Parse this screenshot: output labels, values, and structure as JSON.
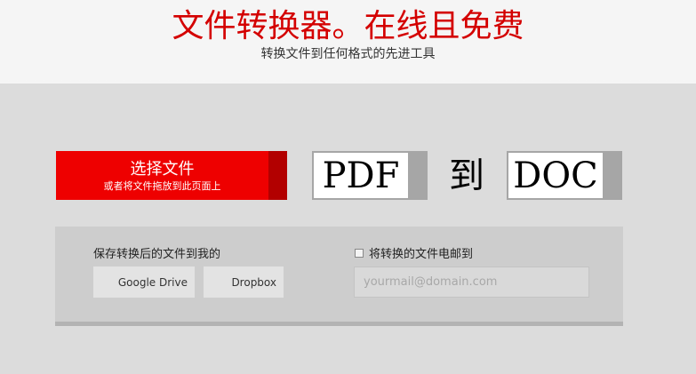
{
  "header": {
    "title": "文件转换器。在线且免费",
    "subtitle": "转换文件到任何格式的先进工具"
  },
  "converter": {
    "choose_label": "选择文件",
    "choose_hint": "或者将文件拖放到此页面上",
    "from_format": "PDF",
    "to_label": "到",
    "to_format": "DOC"
  },
  "save": {
    "label": "保存转换后的文件到我的",
    "services": [
      "Google Drive",
      "Dropbox"
    ]
  },
  "email": {
    "checkbox_label": "将转换的文件电邮到",
    "placeholder": "yourmail@domain.com"
  },
  "colors": {
    "accent": "#ee0000",
    "title": "#d40000"
  }
}
